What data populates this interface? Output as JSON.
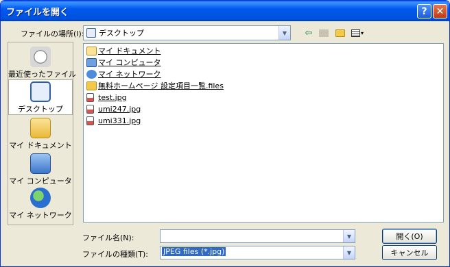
{
  "window": {
    "title": "ファイルを開く"
  },
  "titlebar": {
    "help_glyph": "?",
    "close_glyph": "✕"
  },
  "location": {
    "label": "ファイルの場所(I):",
    "current": "デスクトップ",
    "arrow": "▼"
  },
  "toolbar": {
    "back_icon": "back-icon",
    "up_icon": "up-folder-icon",
    "new_folder_icon": "new-folder-icon",
    "view_menu_icon": "view-menu-icon"
  },
  "places": [
    {
      "label": "最近使ったファイル",
      "icon": "recent-files-icon"
    },
    {
      "label": "デスクトップ",
      "icon": "desktop-icon",
      "selected": true
    },
    {
      "label": "マイ ドキュメント",
      "icon": "my-documents-icon"
    },
    {
      "label": "マイ コンピュータ",
      "icon": "my-computer-icon"
    },
    {
      "label": "マイ ネットワーク",
      "icon": "my-network-icon"
    }
  ],
  "files": [
    {
      "name": "マイ ドキュメント",
      "icon": "my-documents-icon"
    },
    {
      "name": "マイ コンピュータ",
      "icon": "my-computer-icon"
    },
    {
      "name": "マイ ネットワーク",
      "icon": "my-network-icon"
    },
    {
      "name": "無料ホームページ 設定項目一覧.files",
      "icon": "folder-icon"
    },
    {
      "name": "test.jpg",
      "icon": "jpg-file-icon"
    },
    {
      "name": "umi247.jpg",
      "icon": "jpg-file-icon"
    },
    {
      "name": "umi331.jpg",
      "icon": "jpg-file-icon"
    }
  ],
  "filename": {
    "label": "ファイル名(N):",
    "value": ""
  },
  "filetype": {
    "label": "ファイルの種類(T):",
    "value": "JPEG files (*.jpg)"
  },
  "buttons": {
    "open": "開く(O)",
    "cancel": "キャンセル"
  },
  "colors": {
    "title_bar": "#0054E3",
    "dialog_bg": "#ECE9D8",
    "selection": "#316AC5"
  }
}
